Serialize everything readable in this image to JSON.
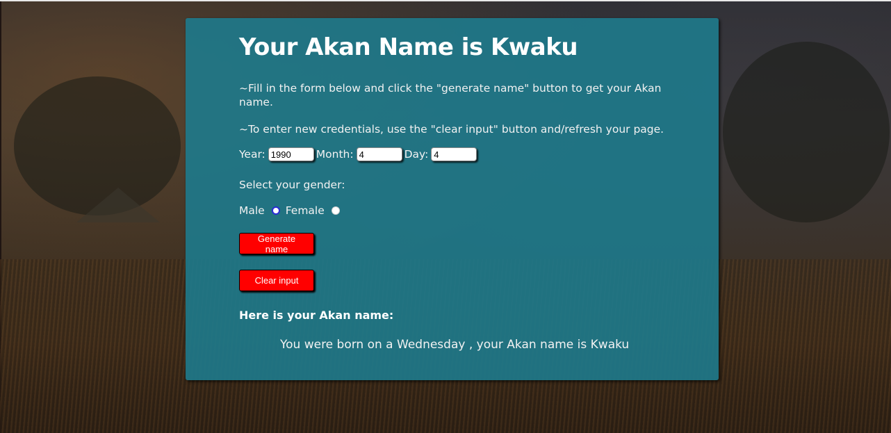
{
  "page": {
    "title": "Your Akan Name is Kwaku",
    "instruction_1": "~Fill in the form below and click the \"generate name\" button to get your Akan name.",
    "instruction_2": "~To enter new credentials, use the \"clear input\" button and/refresh your page."
  },
  "form": {
    "year_label": "Year:",
    "year_value": "1990",
    "month_label": "Month:",
    "month_value": "4",
    "day_label": "Day:",
    "day_value": "4",
    "gender_prompt": "Select your gender:",
    "male_label": "Male",
    "female_label": "Female",
    "selected_gender": "Male",
    "generate_label": "Generate name",
    "clear_label": "Clear input"
  },
  "result": {
    "heading": "Here is your Akan name:",
    "message": "You were born on a Wednesday , your Akan name is Kwaku"
  },
  "colors": {
    "card": "#1e7a8c",
    "button": "#ff0000",
    "radio_selected": "#2b2bd6"
  }
}
